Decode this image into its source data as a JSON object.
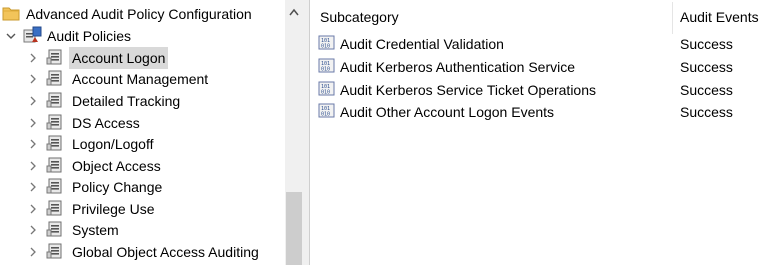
{
  "tree": {
    "root_label": "Advanced Audit Policy Configuration",
    "policies_label": "Audit Policies",
    "items": [
      {
        "label": "Account Logon",
        "selected": true
      },
      {
        "label": "Account Management"
      },
      {
        "label": "Detailed Tracking"
      },
      {
        "label": "DS Access"
      },
      {
        "label": "Logon/Logoff"
      },
      {
        "label": "Object Access"
      },
      {
        "label": "Policy Change"
      },
      {
        "label": "Privilege Use"
      },
      {
        "label": "System"
      },
      {
        "label": "Global Object Access Auditing"
      }
    ]
  },
  "list": {
    "headers": {
      "subcategory": "Subcategory",
      "events": "Audit Events"
    },
    "rows": [
      {
        "name": "Audit Credential Validation",
        "events": "Success"
      },
      {
        "name": "Audit Kerberos Authentication Service",
        "events": "Success"
      },
      {
        "name": "Audit Kerberos Service Ticket Operations",
        "events": "Success"
      },
      {
        "name": "Audit Other Account Logon Events",
        "events": "Success"
      }
    ]
  },
  "icons": {
    "folder": "folder-icon",
    "policies": "audit-policies-icon",
    "category": "policy-category-icon",
    "subcategory": "policy-setting-icon",
    "expand": "chevron-right-icon",
    "collapse": "chevron-down-icon"
  },
  "colors": {
    "selection": "#d9d9d9",
    "scrollbar_thumb": "#cdcdcd"
  }
}
